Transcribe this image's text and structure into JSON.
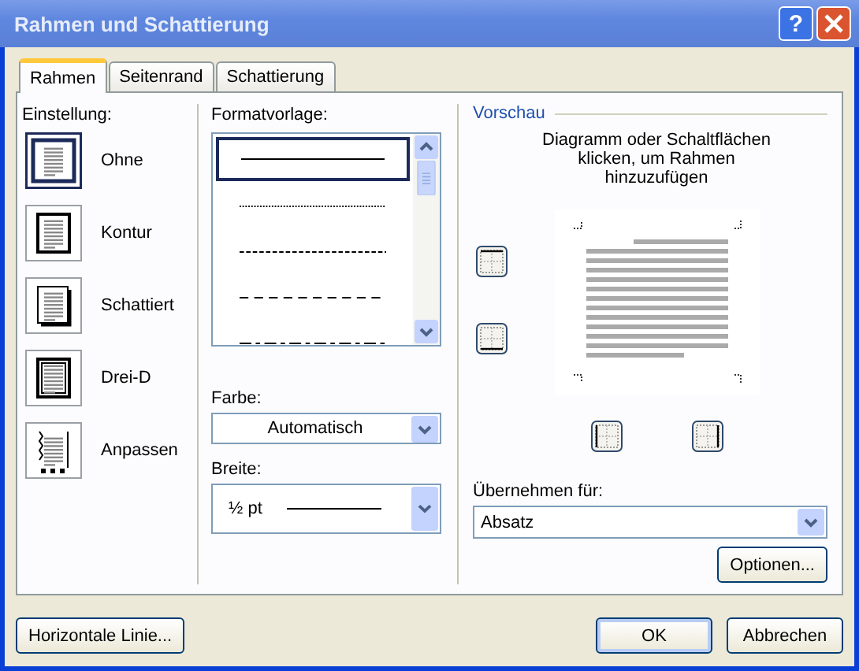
{
  "window": {
    "title": "Rahmen und Schattierung",
    "help_label": "?"
  },
  "tabs": [
    {
      "label": "Rahmen",
      "selected": true
    },
    {
      "label": "Seitenrand",
      "selected": false
    },
    {
      "label": "Schattierung",
      "selected": false
    }
  ],
  "settings": {
    "heading": "Einstellung:",
    "items": [
      {
        "label": "Ohne",
        "kind": "none",
        "selected": true
      },
      {
        "label": "Kontur",
        "kind": "box",
        "selected": false
      },
      {
        "label": "Schattiert",
        "kind": "shadow",
        "selected": false
      },
      {
        "label": "Drei-D",
        "kind": "threed",
        "selected": false
      },
      {
        "label": "Anpassen",
        "kind": "custom",
        "selected": false
      }
    ]
  },
  "style": {
    "heading": "Formatvorlage:",
    "lines": [
      {
        "kind": "solid",
        "selected": true
      },
      {
        "kind": "dotted",
        "selected": false
      },
      {
        "kind": "dashed",
        "selected": false
      },
      {
        "kind": "longdash",
        "selected": false
      },
      {
        "kind": "dashdot",
        "selected": false
      }
    ]
  },
  "color": {
    "label": "Farbe:",
    "value": "Automatisch"
  },
  "width": {
    "label": "Breite:",
    "value": "½ pt"
  },
  "preview": {
    "heading": "Vorschau",
    "hint": "Diagramm oder Schaltflächen klicken, um Rahmen hinzuzufügen",
    "border_buttons": [
      {
        "kind": "top"
      },
      {
        "kind": "bottom"
      },
      {
        "kind": "left"
      },
      {
        "kind": "right"
      }
    ]
  },
  "apply": {
    "label": "Übernehmen für:",
    "value": "Absatz"
  },
  "options_button": "Optionen...",
  "footer": {
    "left_button": "Horizontale Linie...",
    "buttons": [
      "OK",
      "Abbrechen"
    ]
  }
}
